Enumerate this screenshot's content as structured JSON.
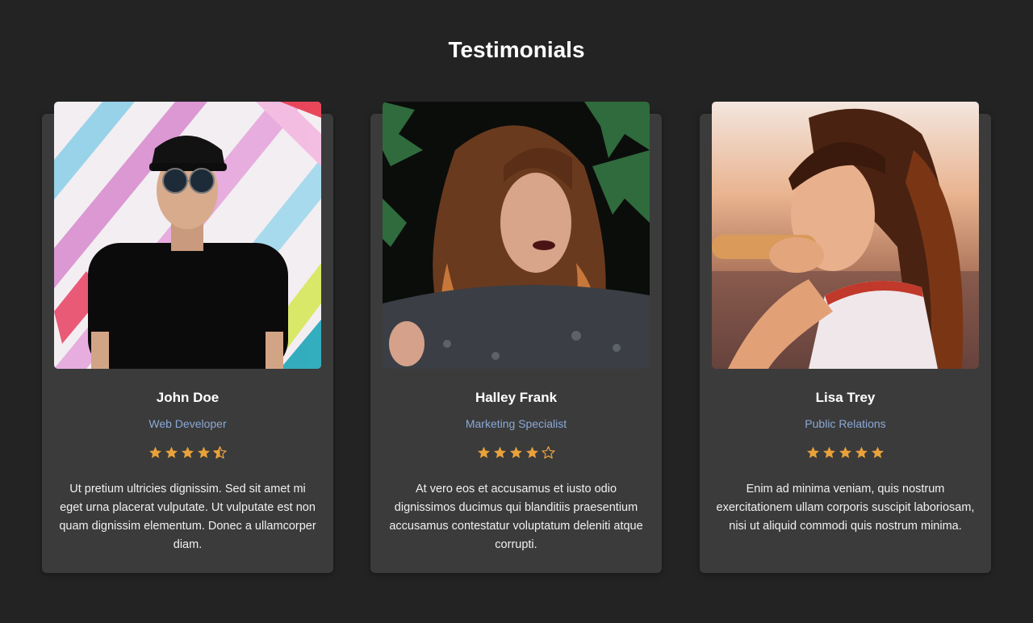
{
  "page": {
    "title": "Testimonials"
  },
  "colors": {
    "background": "#232323",
    "card": "#3b3b3b",
    "role_text": "#8aa9d6",
    "star": "#e9a23b"
  },
  "testimonials": [
    {
      "name": "John Doe",
      "role": "Web Developer",
      "rating": 4.5,
      "stars": [
        "full",
        "full",
        "full",
        "full",
        "half"
      ],
      "text": "Ut pretium ultricies dignissim. Sed sit amet mi eget urna placerat vulputate. Ut vulputate est non quam dignissim elementum. Donec a ullamcorper diam.",
      "photo_icon": "portrait-photo"
    },
    {
      "name": "Halley Frank",
      "role": "Marketing Specialist",
      "rating": 4,
      "stars": [
        "full",
        "full",
        "full",
        "full",
        "empty"
      ],
      "text": "At vero eos et accusamus et iusto odio dignissimos ducimus qui blanditiis praesentium accusamus contestatur voluptatum deleniti atque corrupti.",
      "photo_icon": "portrait-photo"
    },
    {
      "name": "Lisa Trey",
      "role": "Public Relations",
      "rating": 5,
      "stars": [
        "full",
        "full",
        "full",
        "full",
        "full"
      ],
      "text": "Enim ad minima veniam, quis nostrum exercitationem ullam corporis suscipit laboriosam, nisi ut aliquid commodi quis nostrum minima.",
      "photo_icon": "portrait-photo"
    }
  ]
}
